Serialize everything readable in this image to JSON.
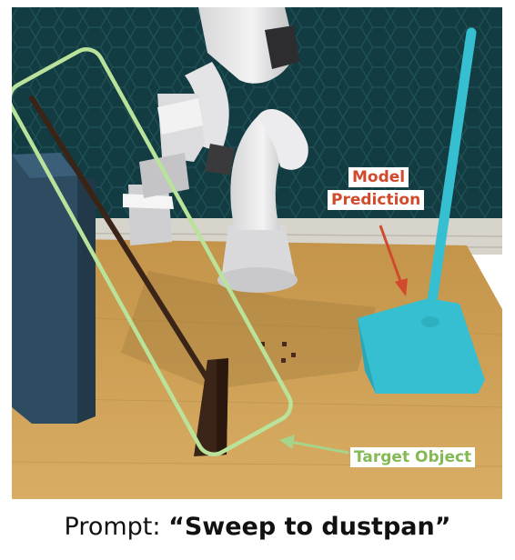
{
  "prediction_label": {
    "line1": "Model",
    "line2": "Prediction"
  },
  "target_label": "Target Object",
  "caption": {
    "prefix": "Prompt: ",
    "prompt": "“Sweep to dustpan”"
  },
  "colors": {
    "prediction": "#d24a2c",
    "target": "#84ba55",
    "prediction_mesh": "#35bfd0",
    "target_box": "#b9e29a",
    "broom": "#3a2418",
    "table": "#c79a4f",
    "backdrop": "#123c41",
    "shelf": "#2f4d62"
  },
  "icons": [
    "robot-arm-image",
    "broom-image",
    "dustpan-image",
    "shelf-image"
  ]
}
